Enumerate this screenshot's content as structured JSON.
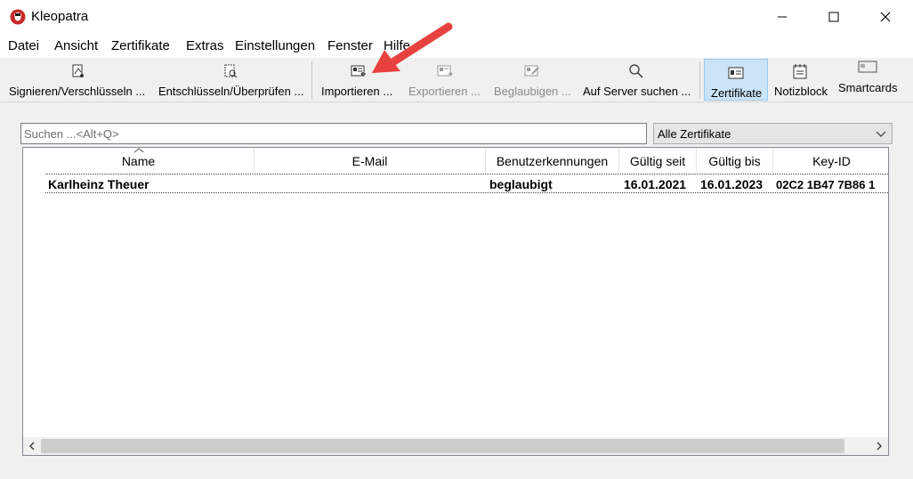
{
  "window": {
    "title": "Kleopatra"
  },
  "menu": [
    "Datei",
    "Ansicht",
    "Zertifikate",
    "Extras",
    "Einstellungen",
    "Fenster",
    "Hilfe"
  ],
  "toolbar": {
    "sign_encrypt": "Signieren/Verschlüsseln ...",
    "decrypt_verify": "Entschlüsseln/Überprüfen ...",
    "import": "Importieren ...",
    "export": "Exportieren ...",
    "certify": "Beglaubigen ...",
    "lookup": "Auf Server suchen ...",
    "certificates": "Zertifikate",
    "notepad": "Notizblock",
    "smartcards": "Smartcards"
  },
  "search": {
    "placeholder": "Suchen ...<Alt+Q>"
  },
  "filter": {
    "selected": "Alle Zertifikate"
  },
  "table": {
    "columns": [
      "Name",
      "E-Mail",
      "Benutzerkennungen",
      "Gültig seit",
      "Gültig bis",
      "Key-ID"
    ],
    "rows": [
      {
        "name": "Karlheinz Theuer",
        "email": "",
        "user_ids": "beglaubigt",
        "valid_from": "16.01.2021",
        "valid_until": "16.01.2023",
        "key_id": "02C2 1B47 7B86 1"
      }
    ]
  },
  "colors": {
    "accent_arrow": "#e8423f",
    "active_tab_bg": "#cce4f7"
  }
}
